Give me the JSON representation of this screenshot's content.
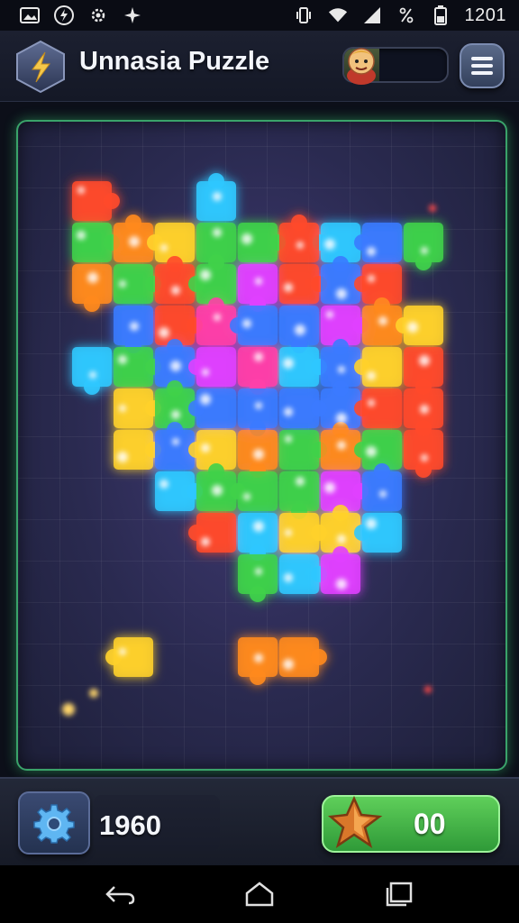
{
  "status_bar": {
    "time": "1201",
    "left_icons": [
      "image-icon",
      "lightning-icon",
      "settings-icon",
      "sparkle-icon"
    ],
    "right_icons": [
      "vibrate-icon",
      "wifi-icon",
      "signal-icon",
      "percent-icon",
      "battery-icon"
    ]
  },
  "header": {
    "title": "Unnasia Puzzle",
    "logo_icon": "lightning-hex-icon",
    "avatar_icon": "character-avatar-icon",
    "menu_icon": "hamburger-menu-icon"
  },
  "bottom_bar": {
    "score": "1960",
    "settings_icon": "gear-icon",
    "play_button_label": "00",
    "play_button_icon": "star-icon"
  },
  "nav_bar": {
    "back_icon": "back-arrow-icon",
    "home_icon": "home-icon",
    "recents_icon": "recents-icon"
  },
  "colors": {
    "board_border": "#3aa36a",
    "play_button": "#3fae45",
    "background": "#0c0f19"
  }
}
